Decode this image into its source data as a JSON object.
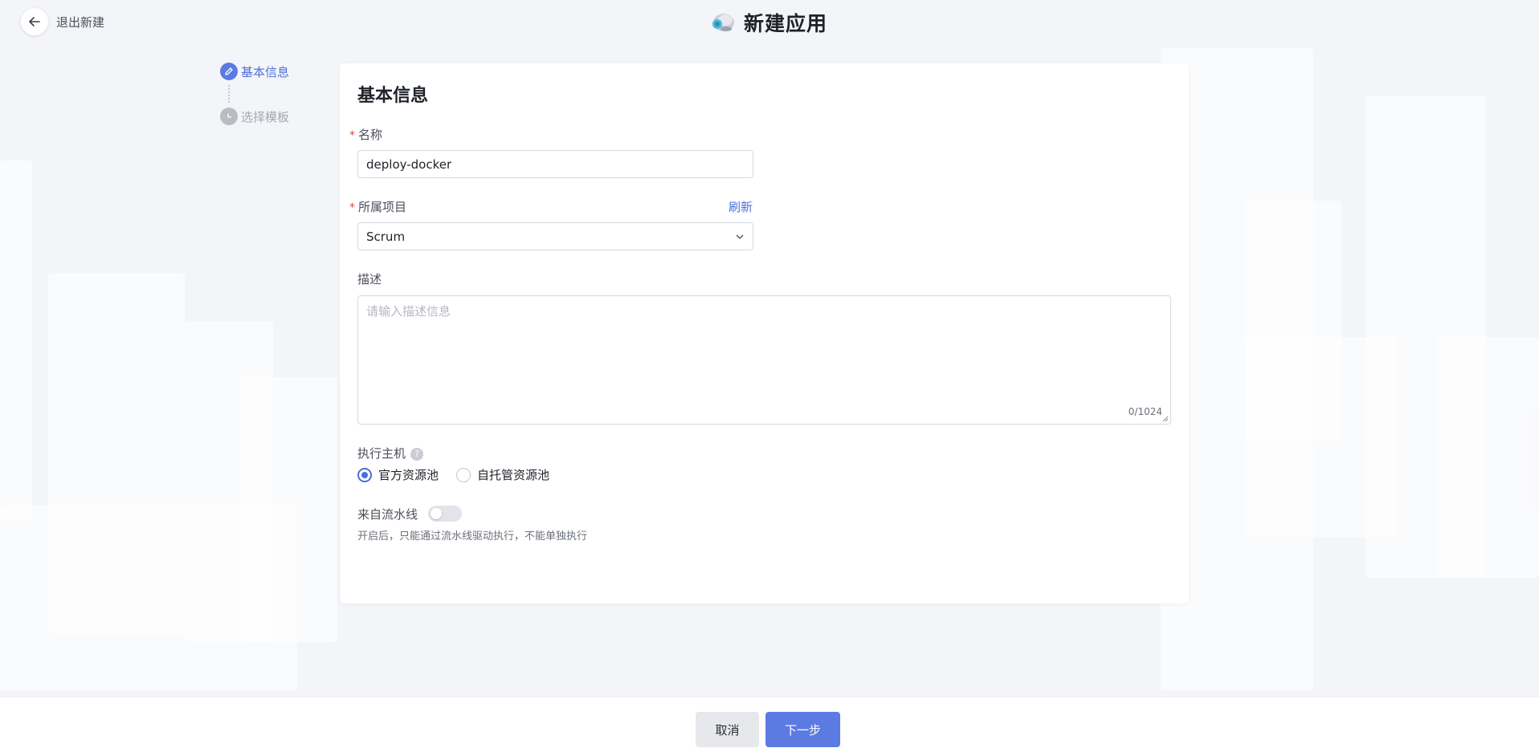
{
  "header": {
    "back_label": "退出新建",
    "title": "新建应用"
  },
  "steps": [
    {
      "label": "基本信息",
      "state": "active"
    },
    {
      "label": "选择模板",
      "state": "pending"
    }
  ],
  "form": {
    "section_title": "基本信息",
    "name": {
      "label": "名称",
      "required": true,
      "value": "deploy-docker"
    },
    "project": {
      "label": "所属项目",
      "required": true,
      "refresh_label": "刷新",
      "selected": "Scrum"
    },
    "description": {
      "label": "描述",
      "placeholder": "请输入描述信息",
      "counter": "0/1024"
    },
    "executor": {
      "label": "执行主机",
      "options": [
        {
          "label": "官方资源池",
          "checked": true
        },
        {
          "label": "自托管资源池",
          "checked": false
        }
      ]
    },
    "pipeline": {
      "label": "来自流水线",
      "enabled": false,
      "hint": "开启后，只能通过流水线驱动执行，不能单独执行"
    }
  },
  "footer": {
    "cancel_label": "取消",
    "next_label": "下一步"
  },
  "colors": {
    "accent": "#5b7be3",
    "required": "#e54545",
    "background": "#f4f5f9"
  }
}
